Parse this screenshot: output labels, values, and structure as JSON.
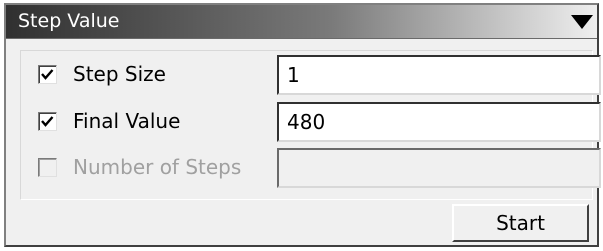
{
  "panel": {
    "title": "Step Value",
    "collapse_icon": "triangle-down-icon"
  },
  "fields": [
    {
      "label": "Step Size",
      "checked": true,
      "enabled": true,
      "value": "1"
    },
    {
      "label": "Final Value",
      "checked": true,
      "enabled": true,
      "value": "480"
    },
    {
      "label": "Number of Steps",
      "checked": false,
      "enabled": false,
      "value": ""
    }
  ],
  "actions": {
    "start_label": "Start"
  },
  "colors": {
    "panel_bg": "#f0f0f0",
    "title_text": "#ffffff",
    "disabled_text": "#a0a0a0"
  }
}
